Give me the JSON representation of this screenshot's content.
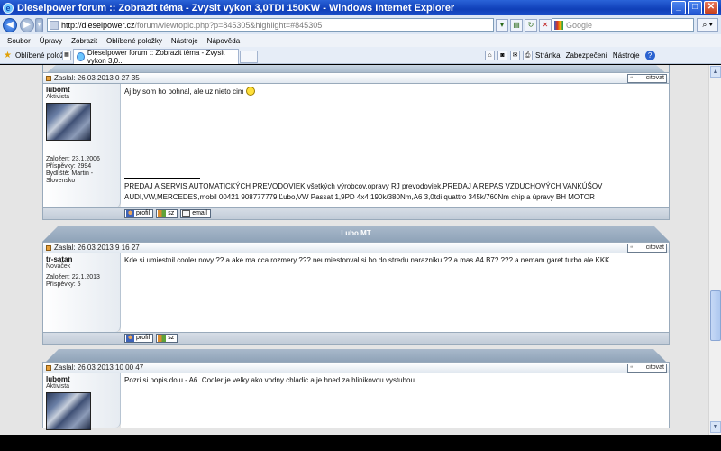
{
  "window": {
    "title": "Dieselpower forum :: Zobrazit téma - Zvysit vykon 3,0TDI 150KW - Windows Internet Explorer"
  },
  "address": {
    "url_host": "http://dieselpower.cz",
    "url_path": "/forum/viewtopic.php?p=845305&highlight=#845305",
    "search_placeholder": "Google"
  },
  "menu": [
    "Soubor",
    "Úpravy",
    "Zobrazit",
    "Oblíbené položky",
    "Nástroje",
    "Nápověda"
  ],
  "favorites": {
    "label": "Oblíbené položky",
    "tab_title": "Dieselpower forum :: Zobrazit téma - Zvysit vykon 3,0..."
  },
  "commandbar": {
    "page": "Stránka",
    "safety": "Zabezpečení",
    "tools": "Nástroje"
  },
  "posts": [
    {
      "posted": "Zaslal: 26 03 2013 0 27 35",
      "quote_label": "citovat",
      "author": "lubomt",
      "rank": "Aktivista",
      "joined": "Založen: 23.1.2006",
      "posts_count": "Příspěvky: 2994",
      "location": "Bydliště: Martin - Slovensko",
      "message": "Aj by som ho pohnal, ale uz nieto cim",
      "signature": "PREDAJ A SERVIS AUTOMATICKÝCH PREVODOVIEK všetkých výrobcov,opravy RJ prevodoviek,PREDAJ A REPAS VZDUCHOVÝCH VANKÚŠOV AUDI,VW,MERCEDES,mobil 00421 908777779 Ľubo,VW Passat 1,9PD 4x4 190k/380Nm,A6 3,0tdi quattro 345k/760Nm chip a úpravy BH MOTOR",
      "buttons": [
        "profil",
        "sz",
        "email"
      ]
    },
    {
      "separator_name": "Lubo MT",
      "posted": "Zaslal: 26 03 2013 9 16 27",
      "quote_label": "citovat",
      "author": "tr-satan",
      "rank": "Nováček",
      "joined": "Založen: 22.1.2013",
      "posts_count": "Příspěvky: 5",
      "message": "Kde si umiestnil cooler novy ?? a ake ma cca rozmery ??? neumiestonval si ho do stredu narazniku ?? a mas A4 B7? ??? a nemam garet turbo ale KKK",
      "buttons": [
        "profil",
        "sz"
      ]
    },
    {
      "posted": "Zaslal: 26 03 2013 10 00 47",
      "quote_label": "citovat",
      "author": "lubomt",
      "rank": "Aktivista",
      "message": "Pozri si popis dolu - A6. Cooler je velky ako vodny chladic a je hned za hlinikovou vystuhou"
    }
  ]
}
